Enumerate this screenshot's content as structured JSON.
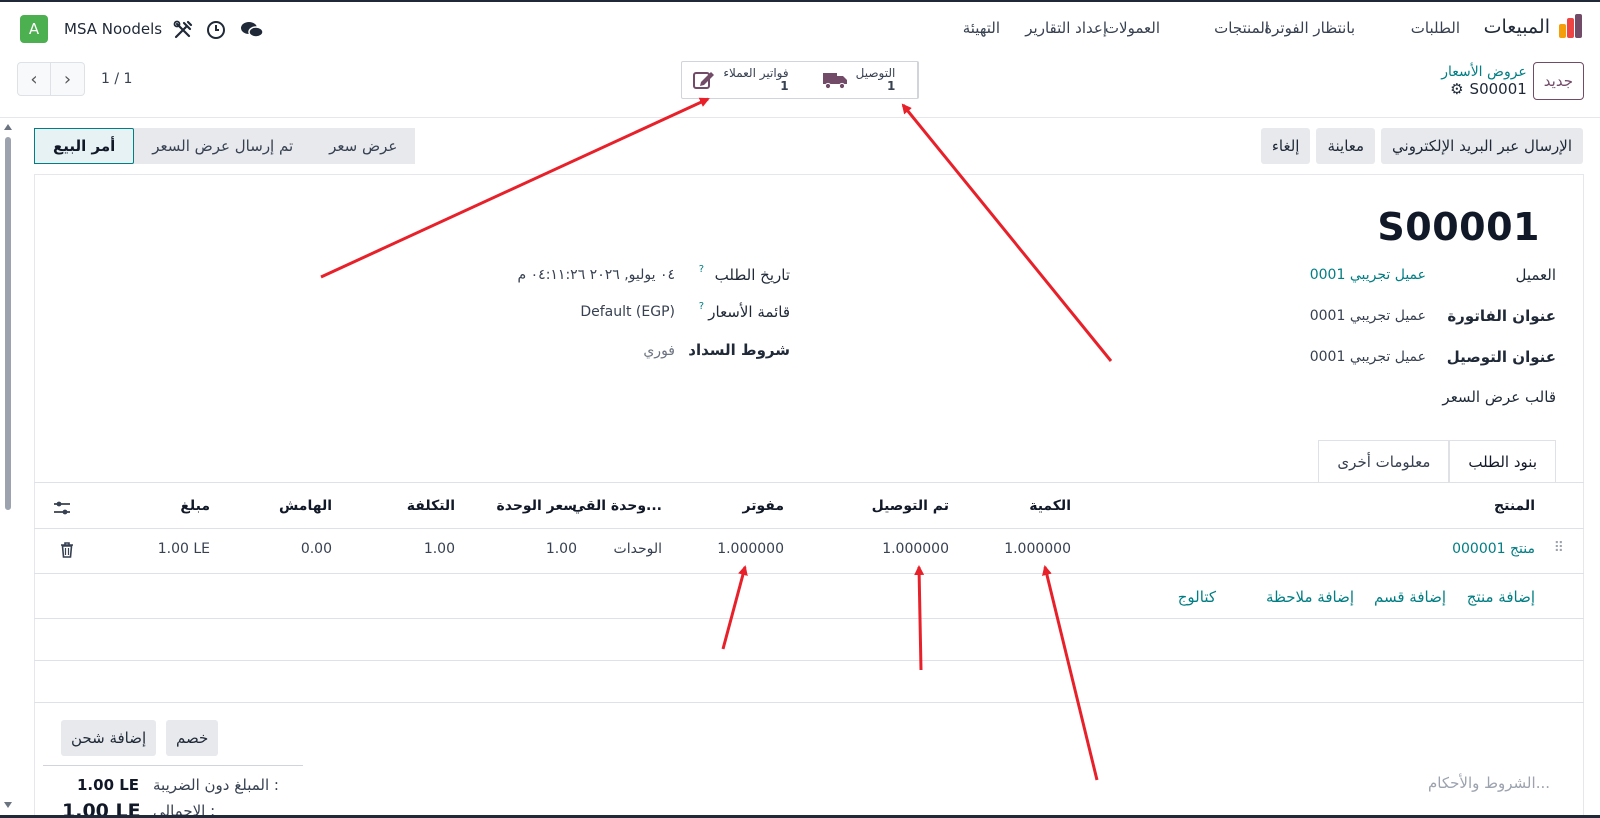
{
  "navbar": {
    "brand": "المبيعات",
    "menu": [
      "الطلبات",
      "بانتظار الفوترة",
      "المنتجات",
      "العمولات",
      "إعداد التقارير",
      "التهيئة"
    ],
    "company": "MSA Noodels",
    "avatar_letter": "A"
  },
  "control": {
    "pager": "1 / 1",
    "new_button": "جديد",
    "breadcrumb_parent": "عروض الأسعار",
    "breadcrumb_current": "S00001",
    "stat_invoices_label": "فواتير العملاء",
    "stat_invoices_value": "1",
    "stat_delivery_label": "التوصيل",
    "stat_delivery_value": "1"
  },
  "actions": {
    "send_email": "الإرسال عبر البريد الإلكتروني",
    "preview": "معاينة",
    "cancel": "إلغاء"
  },
  "status": {
    "steps": [
      "أمر البيع",
      "تم إرسال عرض السعر",
      "عرض سعر"
    ],
    "active_index": 0
  },
  "order": {
    "name": "S00001",
    "customer_label": "العميل",
    "customer_value": "عميل تجريبي 0001",
    "invoice_address_label": "عنوان الفاتورة",
    "invoice_address_value": "عميل تجريبي 0001",
    "delivery_address_label": "عنوان التوصيل",
    "delivery_address_value": "عميل تجريبي 0001",
    "template_label": "قالب عرض السعر",
    "date_label": "تاريخ الطلب",
    "date_value": "٠٤ يوليو, ٢٠٢٦ ٠٤:١١:٢٦ م",
    "pricelist_label": "قائمة الأسعار",
    "pricelist_value": "Default (EGP)",
    "payment_terms_label": "شروط السداد",
    "payment_terms_value": "فوري",
    "help_mark": "?"
  },
  "tabs": [
    "بنود الطلب",
    "معلومات أخرى"
  ],
  "table": {
    "headers": {
      "product": "المنتج",
      "quantity": "الكمية",
      "delivered": "تم التوصيل",
      "invoiced": "مفوتر",
      "uom": "وحدة القي...",
      "unit_price": "سعر الوحدة",
      "cost": "التكلفة",
      "margin": "الهامش",
      "amount": "مبلغ"
    },
    "rows": [
      {
        "product": "منتج 000001",
        "quantity": "1.000000",
        "delivered": "1.000000",
        "invoiced": "1.000000",
        "uom": "الوحدات",
        "unit_price": "1.00",
        "cost": "1.00",
        "margin": "0.00",
        "amount": "1.00 LE"
      }
    ],
    "add_product": "إضافة منتج",
    "add_section": "إضافة قسم",
    "add_note": "إضافة ملاحظة",
    "catalog": "كتالوج"
  },
  "footer": {
    "discount": "خصم",
    "add_shipping": "إضافة شحن",
    "untaxed_label": "المبلغ دون الضريبة :",
    "untaxed_value": "1.00 LE",
    "total_label": "الإجمالي :",
    "total_value": "1.00 LE",
    "terms_placeholder": "الشروط والأحكام..."
  },
  "colors": {
    "accent": "#017e84",
    "brand": "#714b67",
    "annotation": "#e8202a"
  }
}
